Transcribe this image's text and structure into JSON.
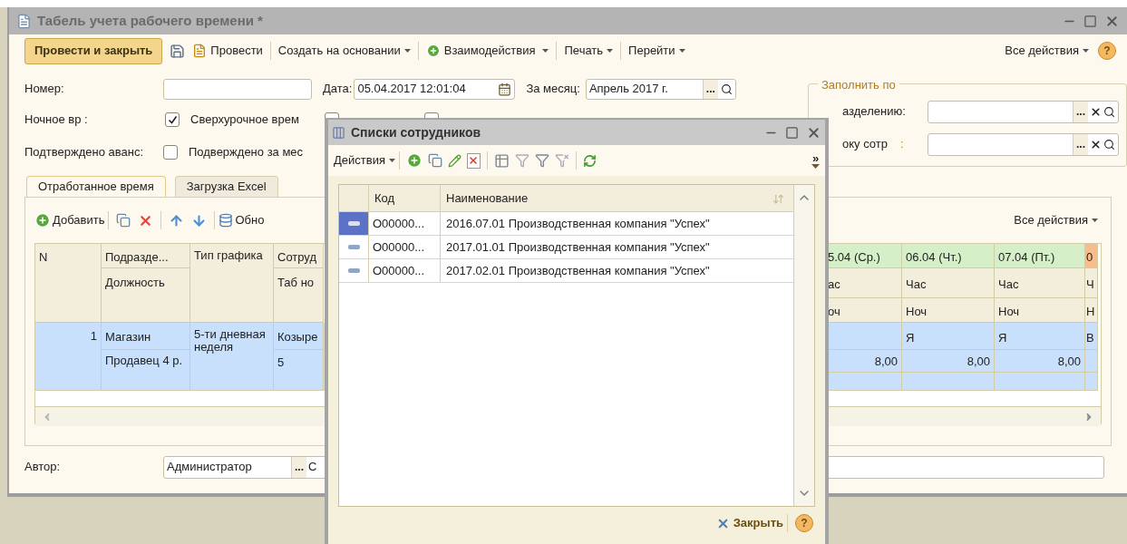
{
  "window": {
    "title": "Табель учета рабочего времени *"
  },
  "toolbar": {
    "primary": "Провести и закрыть",
    "items": [
      {
        "kind": "save"
      },
      {
        "kind": "post",
        "label": "Провести"
      },
      {
        "kind": "menu",
        "label": "Создать на основании"
      },
      {
        "kind": "menu-plus",
        "label": "Взаимодействия"
      },
      {
        "kind": "menu",
        "label": "Печать"
      },
      {
        "kind": "menu",
        "label": "Перейти"
      }
    ],
    "all_actions": "Все действия"
  },
  "number": {
    "label": "Номер:"
  },
  "date": {
    "label": "Дата:",
    "value": "05.04.2017 12:01:04"
  },
  "month": {
    "label": "За месяц:",
    "value": "Апрель 2017 г.",
    "button": "..."
  },
  "checks_row1": [
    {
      "label": "Ночное вр  :",
      "checked": true
    },
    {
      "label": "Сверхурочное  врем",
      "checked": false
    },
    {
      "checked": false
    }
  ],
  "checks_row2": [
    {
      "label": "Подтверждено аванс:",
      "checked": false
    },
    {
      "label": "Подверждено за мес"
    }
  ],
  "fill_group": {
    "title": "Заполнить по",
    "fields": [
      {
        "label": "азделению:",
        "button": "..."
      },
      {
        "label": "оку сотр",
        "colon": ":",
        "button": "..."
      }
    ]
  },
  "tabs": [
    {
      "label": "Отработанное время",
      "selected": true
    },
    {
      "label": "Загрузка Excel",
      "selected": false
    }
  ],
  "grid_toolbar": {
    "add": "Добавить",
    "refresh": "Обно",
    "all_actions": "Все действия"
  },
  "table": {
    "headers": {
      "n": "N",
      "department": "Подразде...",
      "position": "Должность",
      "schedule": "Тип графика",
      "employee": "Сотруд",
      "tab_no": "Таб но"
    },
    "days": [
      {
        "header": "5.04 (Ср.)",
        "color": "#d5efc9",
        "hours_label": "ас",
        "night_label": "оч",
        "value": "8,00"
      },
      {
        "header": "06.04 (Чт.)",
        "color": "#d5efc9",
        "hours_label": "Час",
        "night_label": "Ноч",
        "mark": "Я",
        "value": "8,00"
      },
      {
        "header": "07.04 (Пт.)",
        "color": "#d5efc9",
        "hours_label": "Час",
        "night_label": "Ноч",
        "mark": "Я",
        "value": "8,00"
      },
      {
        "header": "0",
        "color": "#f7bd8a",
        "hours_label": "Ч",
        "night_label": "Н",
        "mark": "В"
      }
    ],
    "rows": [
      {
        "n": "1",
        "department": "Магазин",
        "position": "Продавец 4 р.",
        "schedule": "5-ти дневная неделя",
        "employee": "Козыре",
        "tab_no": "5",
        "selected": true
      }
    ]
  },
  "author": {
    "label": "Автор:",
    "value": "Администратор",
    "button": "...",
    "button2": "С"
  },
  "dialog": {
    "title": "Списки сотрудников",
    "actions": "Действия",
    "more": "»",
    "columns": [
      "Код",
      "Наименование"
    ],
    "rows": [
      {
        "code": "О00000...",
        "name": "2016.07.01 Производственная компания \"Успех\"",
        "selected": true
      },
      {
        "code": "О00000...",
        "name": "2017.01.01 Производственная компания \"Успех\"",
        "selected": false
      },
      {
        "code": "О00000...",
        "name": "2017.02.01 Производственная компания \"Успех\"",
        "selected": false
      }
    ],
    "close": "Закрыть",
    "help": "?"
  },
  "help": "?"
}
